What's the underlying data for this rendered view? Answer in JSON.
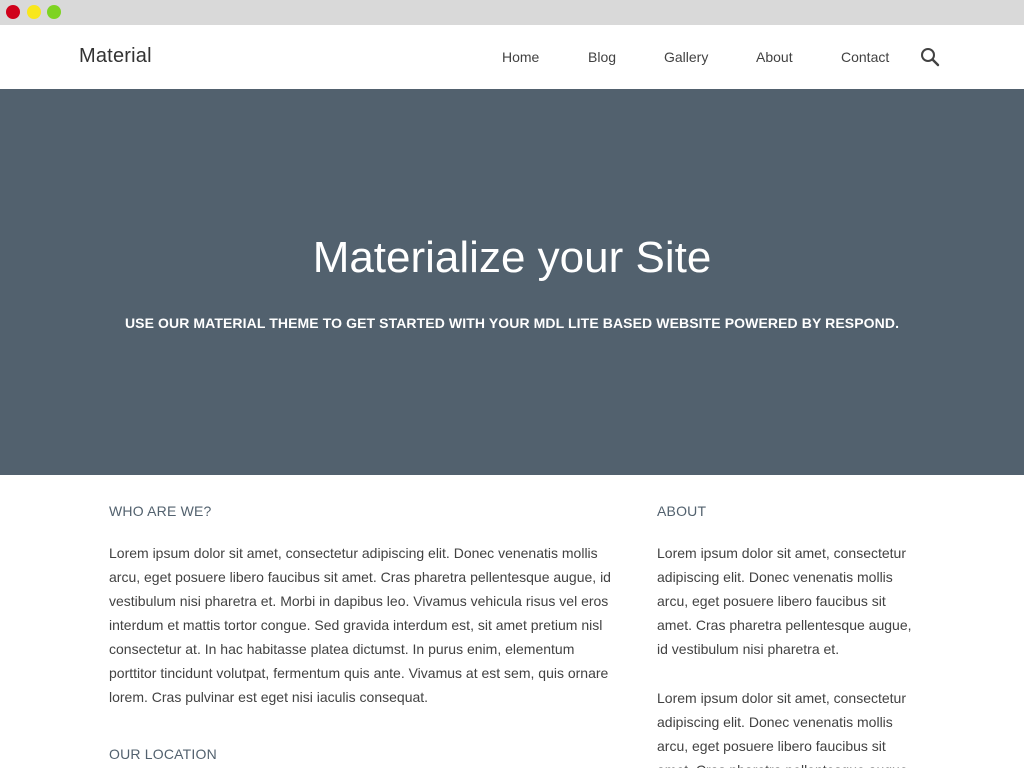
{
  "window": {
    "controls": [
      "close",
      "minimize",
      "zoom"
    ]
  },
  "header": {
    "brand": "Material",
    "nav": {
      "home": "Home",
      "blog": "Blog",
      "gallery": "Gallery",
      "about": "About",
      "contact": "Contact"
    },
    "search_icon": "search-icon"
  },
  "hero": {
    "title": "Materialize your Site",
    "subtitle": "USE OUR MATERIAL THEME TO GET STARTED WITH YOUR MDL LITE BASED WEBSITE POWERED BY RESPOND."
  },
  "main": {
    "who_heading": "WHO ARE WE?",
    "who_text": "Lorem ipsum dolor sit amet, consectetur adipiscing elit. Donec venenatis mollis arcu, eget posuere libero faucibus sit amet. Cras pharetra pellentesque augue, id vestibulum nisi pharetra et. Morbi in dapibus leo. Vivamus vehicula risus vel eros interdum et mattis tortor congue. Sed gravida interdum est, sit amet pretium nisl consectetur at. In hac habitasse platea dictumst. In purus enim, elementum porttitor tincidunt volutpat, fermentum quis ante. Vivamus at est sem, quis ornare lorem. Cras pulvinar est eget nisi iaculis consequat.",
    "location_heading": "OUR LOCATION"
  },
  "sidebar": {
    "about_heading": "ABOUT",
    "about_text_1": "Lorem ipsum dolor sit amet, consectetur adipiscing elit. Donec venenatis mollis arcu, eget posuere libero faucibus sit amet. Cras pharetra pellentesque augue, id vestibulum nisi pharetra et.",
    "about_text_2": "Lorem ipsum dolor sit amet, consectetur adipiscing elit. Donec venenatis mollis arcu, eget posuere libero faucibus sit amet. Cras pharetra pellentesque augue,"
  },
  "colors": {
    "hero_bg": "#52616e",
    "heading_accent": "#52616e",
    "chrome_bg": "#d9d9d9",
    "close": "#d0011b",
    "minimize": "#f8e71c",
    "zoom": "#7ed321"
  }
}
